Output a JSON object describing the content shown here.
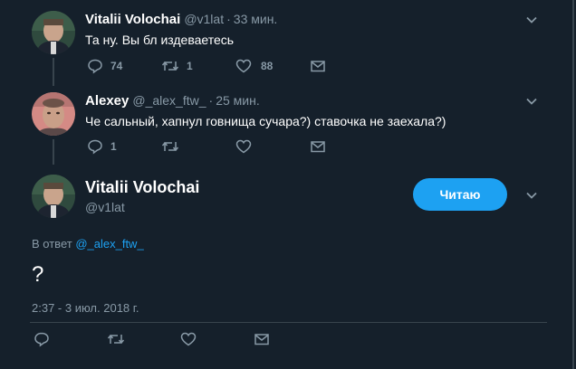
{
  "tweet1": {
    "name": "Vitalii Volochai",
    "handle": "@v1lat",
    "dot": "·",
    "time": "33 мин.",
    "text": "Та ну. Вы бл издеваетесь",
    "replies": "74",
    "retweets": "1",
    "likes": "88"
  },
  "tweet2": {
    "name": "Alexey",
    "handle": "@_alex_ftw_",
    "dot": "·",
    "time": "25 мин.",
    "text": "Че сальный, хапнул говнища сучара?) ставочка не заехала?)",
    "replies": "1"
  },
  "main": {
    "name": "Vitalii Volochai",
    "handle": "@v1lat",
    "follow_label": "Читаю",
    "reply_prefix": "В ответ",
    "reply_to": "@_alex_ftw_",
    "text": "?",
    "timestamp": "2:37 - 3 июл. 2018 г."
  },
  "icons": {
    "reply": "reply-icon",
    "retweet": "retweet-icon",
    "like": "heart-icon",
    "dm": "mail-icon",
    "more": "chevron-down-icon"
  },
  "colors": {
    "background": "#15202b",
    "accent": "#1da1f2",
    "muted": "#8899a6",
    "line": "#38444d"
  }
}
